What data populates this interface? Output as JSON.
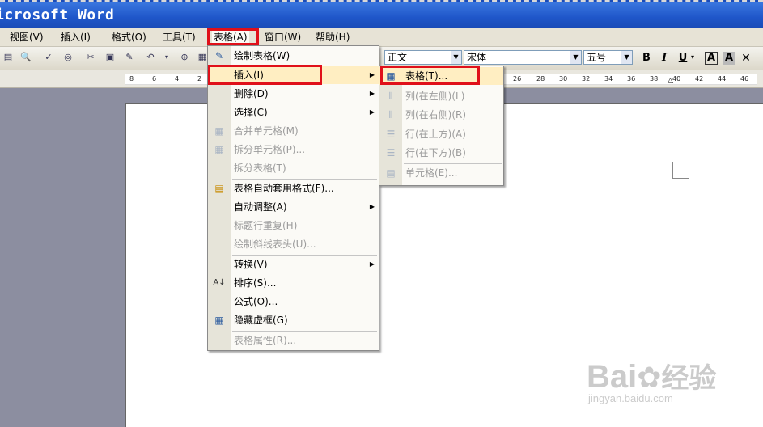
{
  "title_bar": {
    "title": "icrosoft Word"
  },
  "menu_bar": {
    "items": [
      {
        "label": "视图(V)"
      },
      {
        "label": "插入(I)"
      },
      {
        "label": "格式(O)"
      },
      {
        "label": "工具(T)"
      },
      {
        "label": "表格(A)"
      },
      {
        "label": "窗口(W)"
      },
      {
        "label": "帮助(H)"
      }
    ]
  },
  "toolbar": {
    "style_value": "正文",
    "font_value": "宋体",
    "size_value": "五号",
    "bold": "B",
    "italic": "I",
    "underline": "U",
    "font_color": "A",
    "char_shading": "A"
  },
  "ruler": {
    "ticks": [
      "8",
      "6",
      "4",
      "2",
      "26",
      "28",
      "30",
      "32",
      "34",
      "36",
      "38",
      "40",
      "42",
      "44",
      "46"
    ]
  },
  "table_menu": {
    "items": [
      {
        "label": "绘制表格(W)",
        "icon": "pencil-table-icon",
        "enabled": true,
        "submenu": false
      },
      {
        "label": "插入(I)",
        "icon": "",
        "enabled": true,
        "submenu": true,
        "highlighted": true
      },
      {
        "label": "删除(D)",
        "icon": "",
        "enabled": true,
        "submenu": true
      },
      {
        "label": "选择(C)",
        "icon": "",
        "enabled": true,
        "submenu": true
      },
      {
        "label": "合并单元格(M)",
        "icon": "merge-cells-icon",
        "enabled": false,
        "submenu": false
      },
      {
        "label": "拆分单元格(P)...",
        "icon": "split-cells-icon",
        "enabled": false,
        "submenu": false
      },
      {
        "label": "拆分表格(T)",
        "icon": "",
        "enabled": false,
        "submenu": false
      },
      {
        "label": "表格自动套用格式(F)...",
        "icon": "table-autoformat-icon",
        "enabled": true,
        "submenu": false
      },
      {
        "label": "自动调整(A)",
        "icon": "",
        "enabled": true,
        "submenu": true
      },
      {
        "label": "标题行重复(H)",
        "icon": "",
        "enabled": false,
        "submenu": false
      },
      {
        "label": "绘制斜线表头(U)...",
        "icon": "",
        "enabled": false,
        "submenu": false
      },
      {
        "label": "转换(V)",
        "icon": "",
        "enabled": true,
        "submenu": true
      },
      {
        "label": "排序(S)...",
        "icon": "sort-az-icon",
        "enabled": true,
        "submenu": false
      },
      {
        "label": "公式(O)...",
        "icon": "",
        "enabled": true,
        "submenu": false
      },
      {
        "label": "隐藏虚框(G)",
        "icon": "gridlines-icon",
        "enabled": true,
        "submenu": false
      },
      {
        "label": "表格属性(R)...",
        "icon": "",
        "enabled": false,
        "submenu": false
      }
    ]
  },
  "insert_submenu": {
    "items": [
      {
        "label": "表格(T)...",
        "icon": "insert-table-icon",
        "enabled": true,
        "highlighted": true
      },
      {
        "label": "列(在左侧)(L)",
        "icon": "insert-column-left-icon",
        "enabled": false
      },
      {
        "label": "列(在右侧)(R)",
        "icon": "insert-column-right-icon",
        "enabled": false
      },
      {
        "label": "行(在上方)(A)",
        "icon": "insert-row-above-icon",
        "enabled": false
      },
      {
        "label": "行(在下方)(B)",
        "icon": "insert-row-below-icon",
        "enabled": false
      },
      {
        "label": "单元格(E)...",
        "icon": "insert-cells-icon",
        "enabled": false
      }
    ]
  },
  "watermark": {
    "brand": "Bai",
    "brand2": "经验",
    "url": "jingyan.baidu.com"
  },
  "colors": {
    "title_bar": "#1f56c9",
    "highlight": "#ffeec2",
    "red_box": "#e0101a"
  }
}
